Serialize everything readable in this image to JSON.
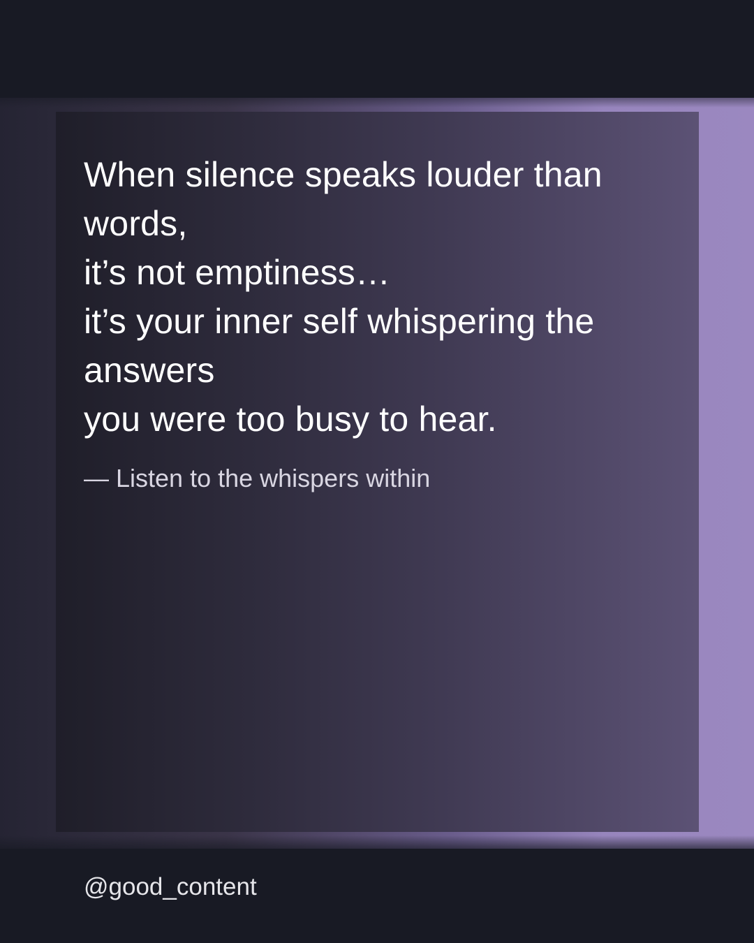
{
  "quote": {
    "lines": [
      "When silence speaks louder than",
      "words,",
      "it’s not emptiness…",
      "it’s your inner self whispering the",
      "answers",
      "you were too busy to hear."
    ]
  },
  "attribution": "— Listen to the whispers within",
  "handle": "@good_content",
  "colors": {
    "background": "#181a24",
    "accent_purple": "#9b88c0",
    "text": "#ffffff"
  }
}
